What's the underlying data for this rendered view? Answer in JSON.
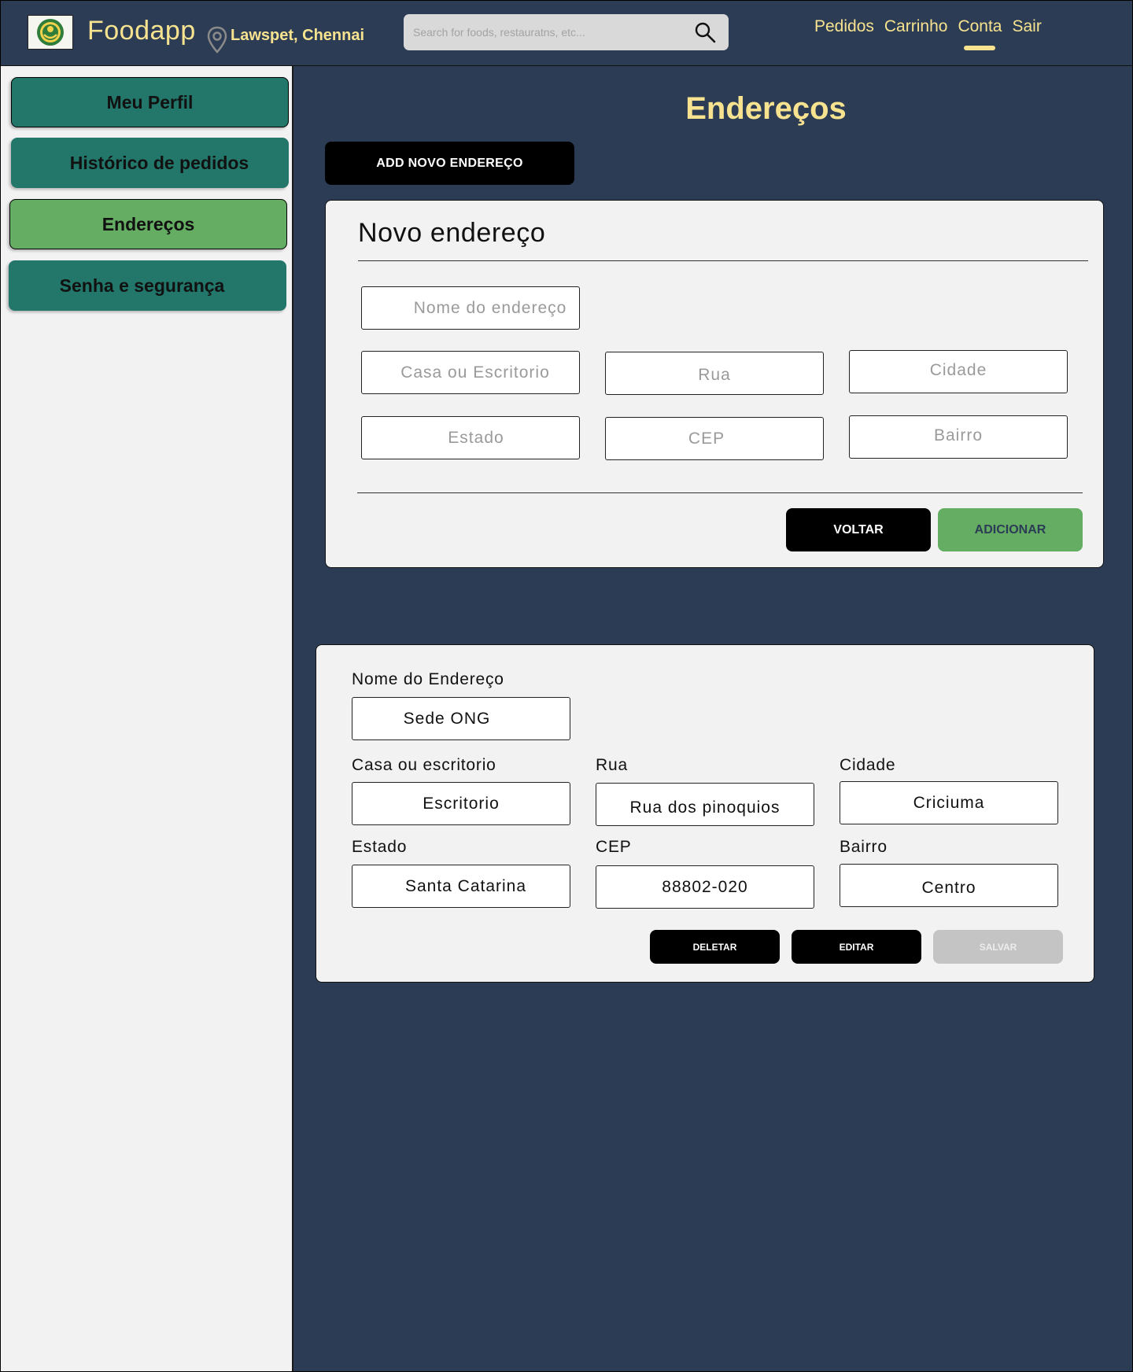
{
  "header": {
    "brand": "Foodapp",
    "location": "Lawspet, Chennai",
    "search_placeholder": "Search for foods, restauratns, etc...",
    "nav": [
      "Pedidos",
      "Carrinho",
      "Conta",
      "Sair"
    ],
    "active_nav": "Conta"
  },
  "sidebar": {
    "items": [
      "Meu Perfil",
      "Histórico de pedidos",
      "Endereços",
      "Senha e segurança"
    ],
    "active": "Endereços"
  },
  "main": {
    "title": "Endereços",
    "add_button": "ADD NOVO ENDEREÇO"
  },
  "new_address_form": {
    "title": "Novo endereço",
    "placeholders": {
      "name": "Nome do endereço",
      "type": "Casa ou Escritorio",
      "street": "Rua",
      "city": "Cidade",
      "state": "Estado",
      "zip": "CEP",
      "district": "Bairro"
    },
    "back_button": "VOLTAR",
    "add_button": "ADICIONAR"
  },
  "saved_address": {
    "labels": {
      "name": "Nome do Endereço",
      "type": "Casa ou escritorio",
      "street": "Rua",
      "city": "Cidade",
      "state": "Estado",
      "zip": "CEP",
      "district": "Bairro"
    },
    "values": {
      "name": "Sede ONG",
      "type": "Escritorio",
      "street": "Rua dos pinoquios",
      "city": "Criciuma",
      "state": "Santa Catarina",
      "zip": "88802-020",
      "district": "Centro"
    },
    "delete_button": "DELETAR",
    "edit_button": "EDITAR",
    "save_button": "SALVAR"
  },
  "colors": {
    "background": "#2c3c55",
    "accent_yellow": "#f7e38f",
    "sidebar_button": "#22776a",
    "active_green": "#64ad62",
    "disabled_gray": "#c4c4c4"
  },
  "icons": [
    "logo-icon",
    "location-pin-icon",
    "search-icon"
  ]
}
